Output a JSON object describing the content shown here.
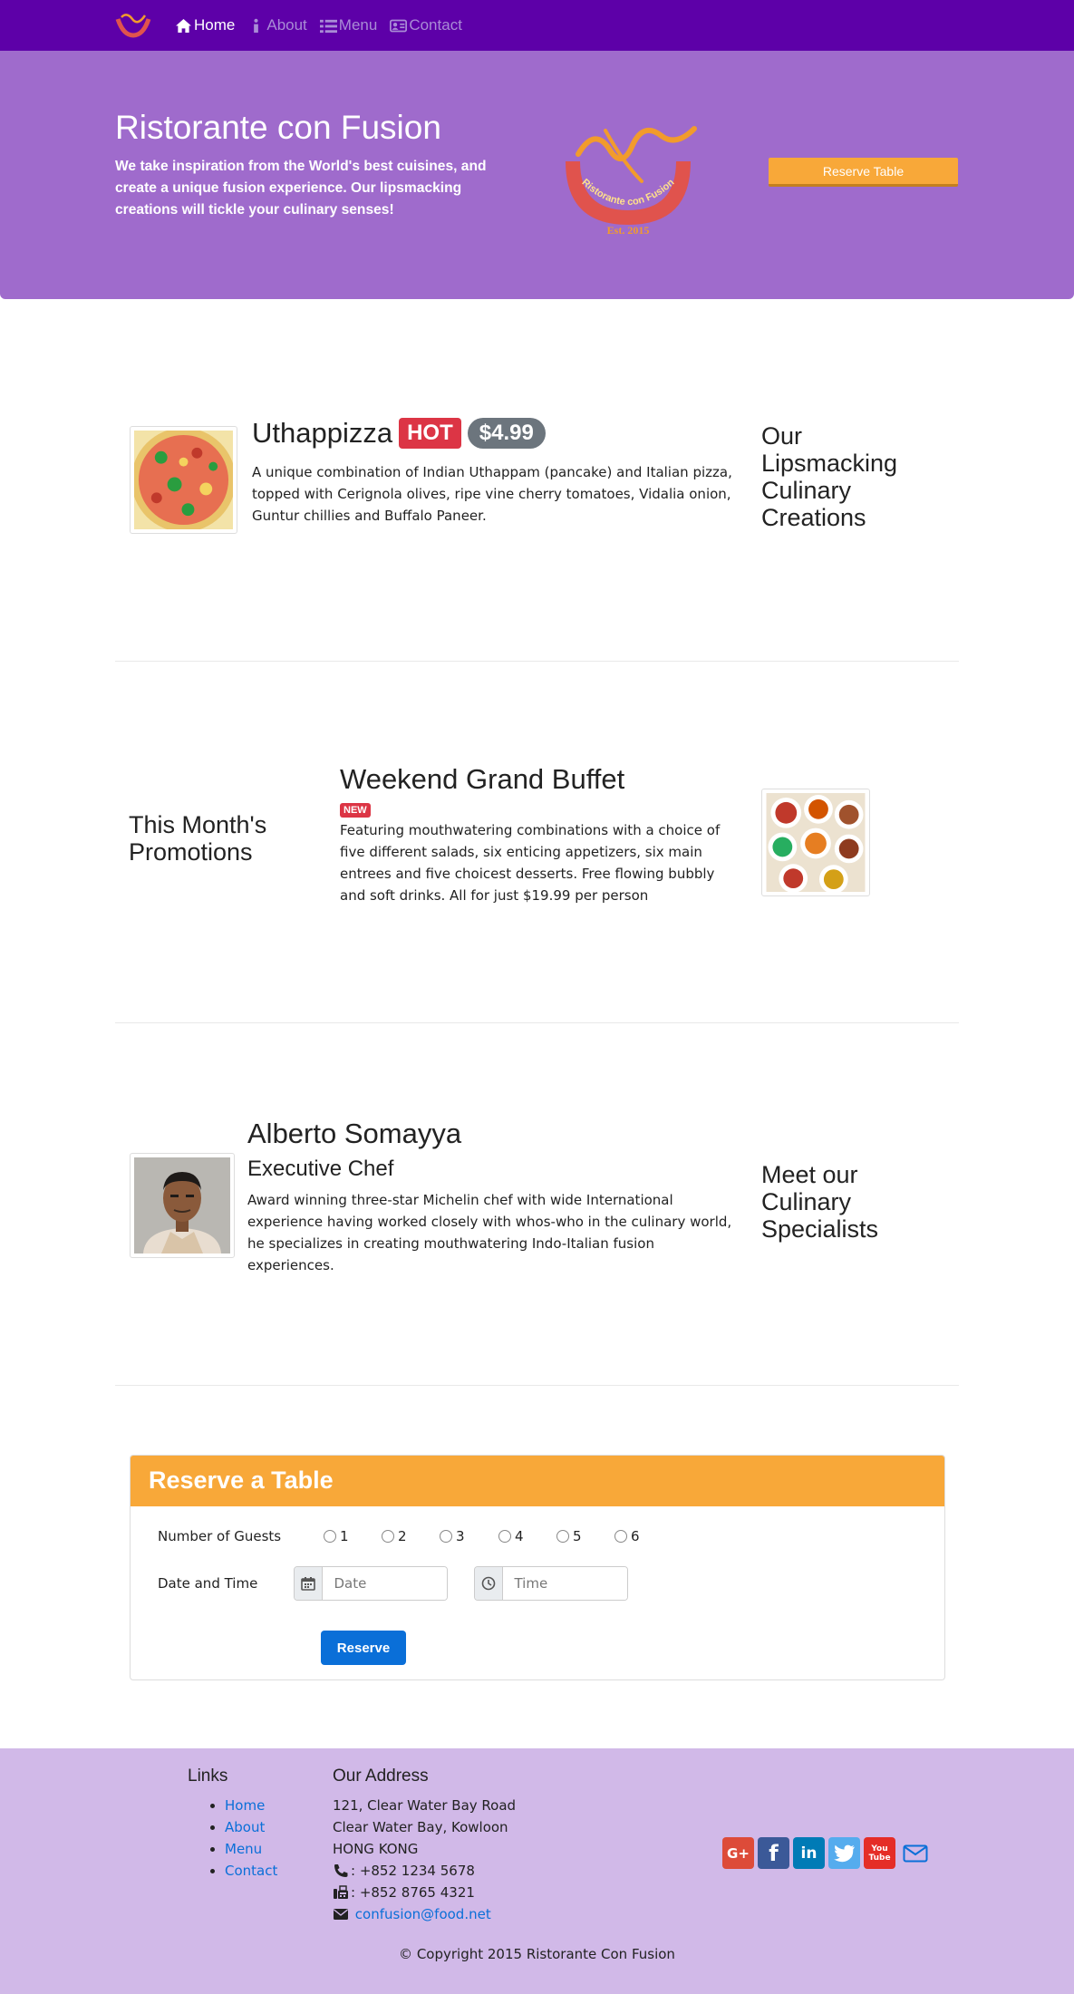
{
  "nav": {
    "items": [
      {
        "label": "Home",
        "icon": "home-icon",
        "active": true
      },
      {
        "label": "About",
        "icon": "info-icon",
        "active": false
      },
      {
        "label": "Menu",
        "icon": "list-icon",
        "active": false
      },
      {
        "label": "Contact",
        "icon": "address-card-icon",
        "active": false
      }
    ]
  },
  "jumbotron": {
    "title": "Ristorante con Fusion",
    "text": "We take inspiration from the World's best cuisines, and create a unique fusion experience. Our lipsmacking creations will tickle your culinary senses!",
    "logo_text": "Ristorante con Fusion",
    "logo_est": "Est. 2015",
    "reserve_button": "Reserve Table"
  },
  "dish": {
    "name": "Uthappizza",
    "badge": "HOT",
    "price": "$4.99",
    "description": "A unique combination of Indian Uthappam (pancake) and Italian pizza, topped with Cerignola olives, ripe vine cherry tomatoes, Vidalia onion, Guntur chillies and Buffalo Paneer.",
    "side_heading": "Our Lipsmacking Culinary Creations"
  },
  "promotion": {
    "side_heading": "This Month's Promotions",
    "name": "Weekend Grand Buffet",
    "badge": "NEW",
    "description": "Featuring mouthwatering combinations with a choice of five different salads, six enticing appetizers, six main entrees and five choicest desserts. Free flowing bubbly and soft drinks. All for just $19.99 per person"
  },
  "leader": {
    "name": "Alberto Somayya",
    "designation": "Executive Chef",
    "description": "Award winning three-star Michelin chef with wide International experience having worked closely with whos-who in the culinary world, he specializes in creating mouthwatering Indo-Italian fusion experiences.",
    "side_heading": "Meet our Culinary Specialists"
  },
  "reserve": {
    "title": "Reserve a Table",
    "guests_label": "Number of Guests",
    "guest_options": [
      "1",
      "2",
      "3",
      "4",
      "5",
      "6"
    ],
    "datetime_label": "Date and Time",
    "date_placeholder": "Date",
    "time_placeholder": "Time",
    "submit": "Reserve"
  },
  "footer": {
    "links_heading": "Links",
    "links": [
      "Home",
      "About",
      "Menu",
      "Contact"
    ],
    "address_heading": "Our Address",
    "address_lines": [
      "121, Clear Water Bay Road",
      "Clear Water Bay, Kowloon",
      "HONG KONG"
    ],
    "phone": ": +852 1234 5678",
    "fax": ": +852 8765 4321",
    "email": "confusion@food.net",
    "social": [
      {
        "icon": "google-plus-icon",
        "label": "G+",
        "color": "#dd4b39"
      },
      {
        "icon": "facebook-icon",
        "label": "f",
        "color": "#3b5998"
      },
      {
        "icon": "linkedin-icon",
        "label": "in",
        "color": "#007bb6"
      },
      {
        "icon": "twitter-icon",
        "label": "t",
        "color": "#55acee"
      },
      {
        "icon": "youtube-icon",
        "label": "You Tube",
        "color": "#e52d27"
      }
    ],
    "copyright": "© Copyright 2015 Ristorante Con Fusion"
  },
  "colors": {
    "navbar": "#5d00a8",
    "jumbotron": "#9f6bcc",
    "accent": "#f8a839",
    "footer": "#d1b9e8",
    "primary": "#0a6fd8",
    "danger": "#dc3545"
  }
}
